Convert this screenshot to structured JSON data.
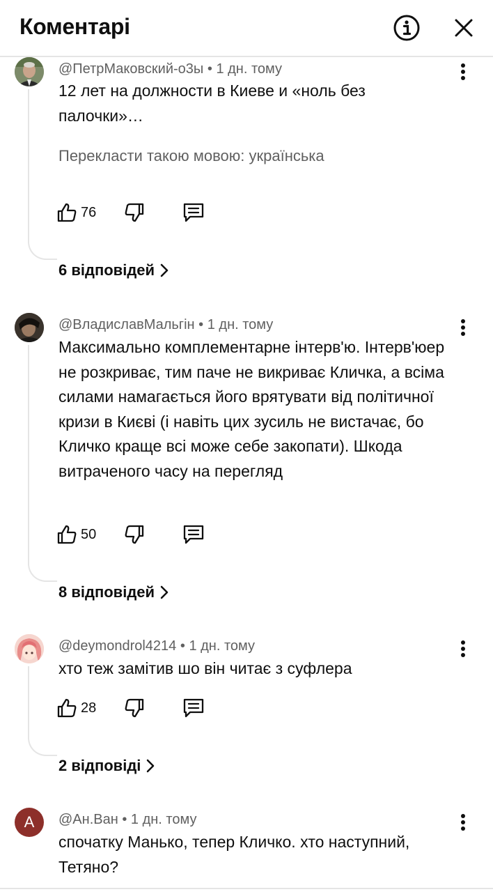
{
  "header": {
    "title": "Коментарі"
  },
  "comments": [
    {
      "author": "@ПетрМаковский-о3ы",
      "time": "1 дн. тому",
      "text": "12 лет на должности в Киеве и «ноль без палочки»…",
      "translate": "Перекласти такою мовою: українська",
      "likes": "76",
      "replies": "6 відповідей"
    },
    {
      "author": "@ВладиславМальгін",
      "time": "1 дн. тому",
      "text": "Максимально комплементарне інтерв'ю. Інтерв'юер не розкриває, тим паче не викриває Кличка, а всіма силами намагається його врятувати від політичної кризи в Києві (і навіть цих зусиль не вистачає, бо Кличко краще всі може себе закопати). Шкода витраченого часу на перегляд",
      "likes": "50",
      "replies": "8 відповідей"
    },
    {
      "author": "@deymondrol4214",
      "time": "1 дн. тому",
      "text": "хто теж замітив шо він читає з суфлера",
      "likes": "28",
      "replies": "2 відповіді"
    },
    {
      "author": "@Ан.Ван",
      "time": "1 дн. тому",
      "avatar_letter": "A",
      "text": "спочатку Манько, тепер Кличко. хто наступний, Тетяно?"
    }
  ],
  "separator": "•",
  "colors": {
    "text": "#0f0f0f",
    "secondary": "#606060",
    "divider": "#e5e5e5",
    "avatar_letter_bg": "#8d2f2a"
  }
}
